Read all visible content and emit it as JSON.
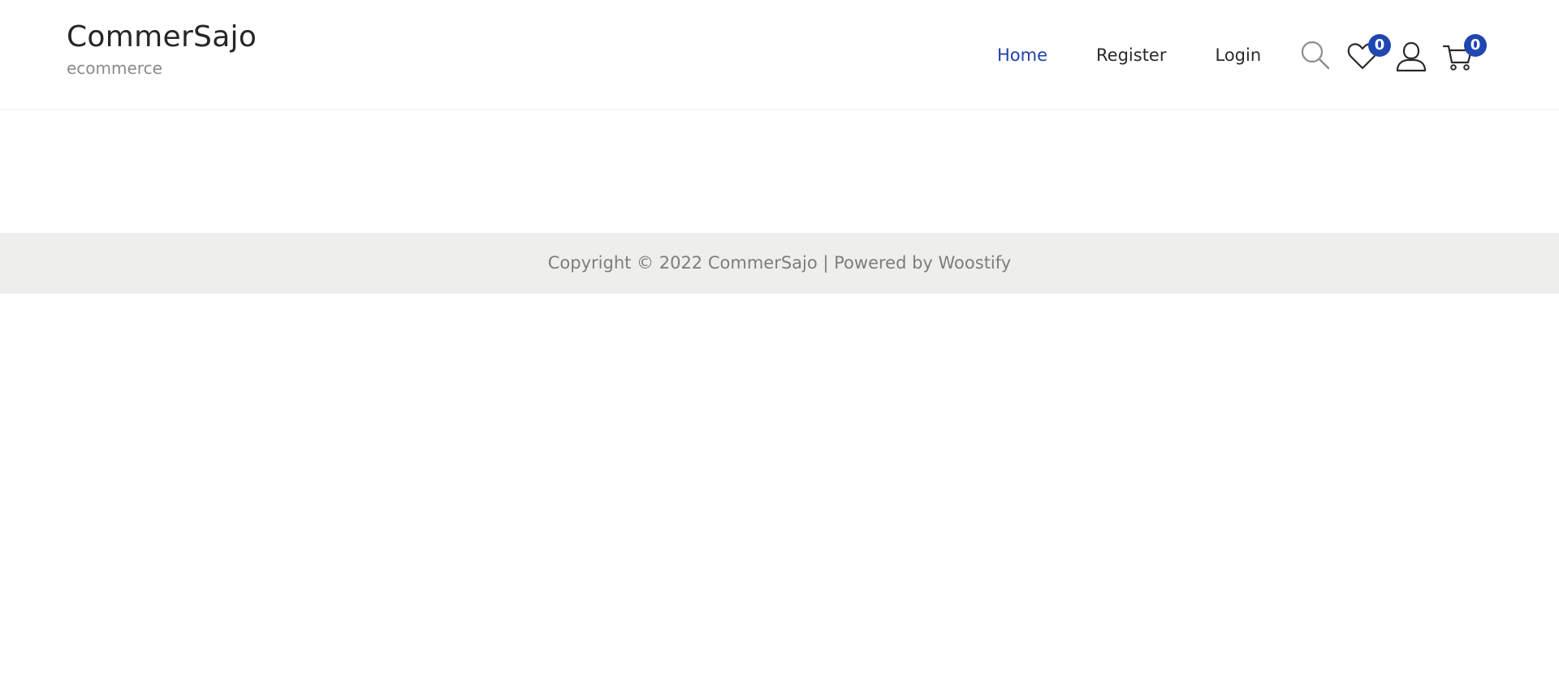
{
  "site": {
    "title": "CommerSajo",
    "tagline": "ecommerce"
  },
  "nav": {
    "items": [
      {
        "label": "Home",
        "active": true
      },
      {
        "label": "Register",
        "active": false
      },
      {
        "label": "Login",
        "active": false
      }
    ]
  },
  "header_icons": {
    "search": {
      "icon": "search-icon"
    },
    "wishlist": {
      "icon": "heart-icon",
      "count": "0"
    },
    "account": {
      "icon": "user-icon"
    },
    "cart": {
      "icon": "cart-icon",
      "count": "0"
    }
  },
  "footer": {
    "copyright": "Copyright © 2022 CommerSajo | Powered by Woostify"
  },
  "colors": {
    "accent": "#1e47b0",
    "nav_active": "#2042a8",
    "footer_bg": "#eeeeec"
  }
}
